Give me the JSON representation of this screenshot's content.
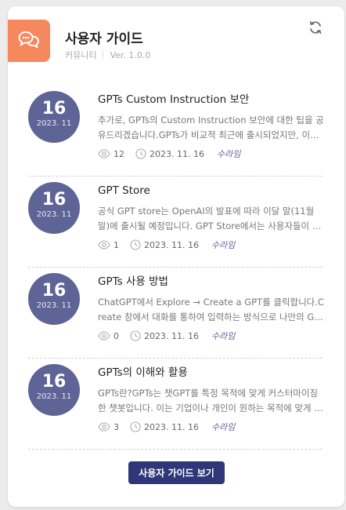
{
  "header": {
    "title": "사용자 가이드",
    "category": "커뮤니티",
    "version": "Ver. 1.0.0",
    "badge_icon": "chat-bubbles-icon",
    "refresh_icon": "refresh-icon"
  },
  "items": [
    {
      "day": "16",
      "year_month": "2023. 11",
      "title": "GPTs Custom Instruction 보안",
      "desc": "추가로, GPTs의 Custom Instruction 보안에 대한 팁을 공유드리겠습니다.GPTs가 비교적 최근에 출시되었지만, 이미 다양한 활용 사례들이 공유되고 있습니다.",
      "views": "12",
      "date": "2023. 11. 16",
      "author": "수라임"
    },
    {
      "day": "16",
      "year_month": "2023. 11",
      "title": "GPT Store",
      "desc": "공식 GPT store는 OpenAI의 발표에 따라 이달 말(11월 말)에 출시될 예정입니다. GPT Store에서는 사용자들이 만든 GPTs를 공유하고 검색할 수 있습니다.",
      "views": "1",
      "date": "2023. 11. 16",
      "author": "수라임"
    },
    {
      "day": "16",
      "year_month": "2023. 11",
      "title": "GPTs 사용 방법",
      "desc": "ChatGPT에서 Explore → Create a GPT를 클릭합니다.Create 창에서 대화를 통하여 입력하는 방식으로 나만의 GPT를 만들 수 있습니다.",
      "views": "0",
      "date": "2023. 11. 16",
      "author": "수라임"
    },
    {
      "day": "16",
      "year_month": "2023. 11",
      "title": "GPTs의 이해와 활용",
      "desc": "GPTs란?GPTs는 챗GPT를 특정 목적에 맞게 커스터마이징한 챗봇입니다. 이는 기업이나 개인이 원하는 목적에 맞게 챗봇을 만들 수 있게 해줍니다.",
      "views": "3",
      "date": "2023. 11. 16",
      "author": "수라임"
    }
  ],
  "footer": {
    "button_label": "사용자 가이드 보기"
  },
  "colors": {
    "badge": "#f6885e",
    "date_circle": "#5e6496",
    "button": "#2f3778"
  }
}
